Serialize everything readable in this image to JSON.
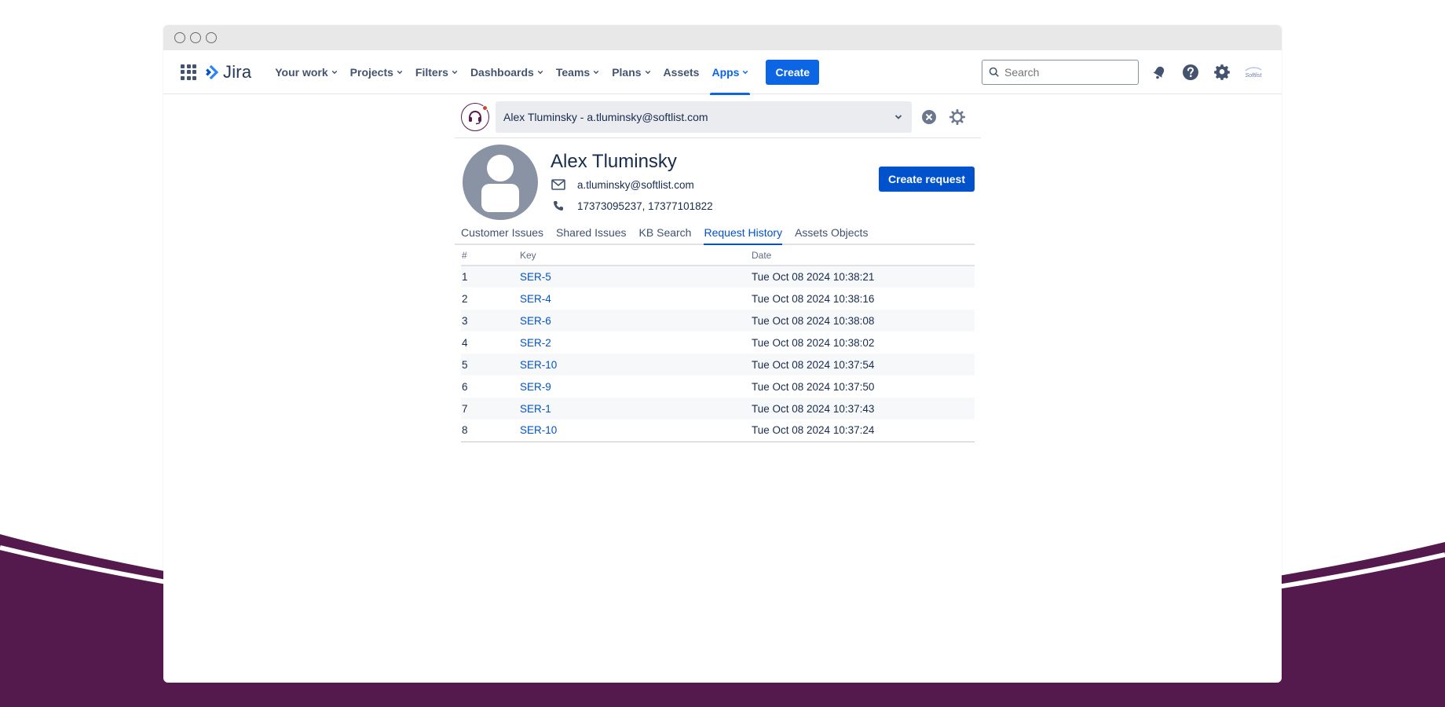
{
  "nav": {
    "logo": "Jira",
    "items": [
      {
        "label": "Your work",
        "dropdown": true
      },
      {
        "label": "Projects",
        "dropdown": true
      },
      {
        "label": "Filters",
        "dropdown": true
      },
      {
        "label": "Dashboards",
        "dropdown": true
      },
      {
        "label": "Teams",
        "dropdown": true
      },
      {
        "label": "Plans",
        "dropdown": true
      },
      {
        "label": "Assets",
        "dropdown": false
      },
      {
        "label": "Apps",
        "dropdown": true,
        "active": true
      }
    ],
    "create_label": "Create",
    "search_placeholder": "Search",
    "profile_logo_text": "Softlist"
  },
  "customer_picker": {
    "selected": "Alex Tluminsky - a.tluminsky@softlist.com"
  },
  "profile": {
    "name": "Alex Tluminsky",
    "email": "a.tluminsky@softlist.com",
    "phone": "17373095237, 17377101822",
    "create_request_label": "Create request"
  },
  "tabs": [
    {
      "label": "Customer Issues"
    },
    {
      "label": "Shared Issues"
    },
    {
      "label": "KB Search"
    },
    {
      "label": "Request History",
      "active": true
    },
    {
      "label": "Assets Objects"
    }
  ],
  "table": {
    "columns": [
      "#",
      "Key",
      "Date"
    ],
    "rows": [
      {
        "num": "1",
        "key": "SER-5",
        "date": "Tue Oct 08 2024 10:38:21"
      },
      {
        "num": "2",
        "key": "SER-4",
        "date": "Tue Oct 08 2024 10:38:16"
      },
      {
        "num": "3",
        "key": "SER-6",
        "date": "Tue Oct 08 2024 10:38:08"
      },
      {
        "num": "4",
        "key": "SER-2",
        "date": "Tue Oct 08 2024 10:38:02"
      },
      {
        "num": "5",
        "key": "SER-10",
        "date": "Tue Oct 08 2024 10:37:54"
      },
      {
        "num": "6",
        "key": "SER-9",
        "date": "Tue Oct 08 2024 10:37:50"
      },
      {
        "num": "7",
        "key": "SER-1",
        "date": "Tue Oct 08 2024 10:37:43"
      },
      {
        "num": "8",
        "key": "SER-10",
        "date": "Tue Oct 08 2024 10:37:24"
      }
    ]
  },
  "colors": {
    "accent": "#0c66e4",
    "button": "#0052cc",
    "background_wave": "#54194d",
    "avatar": "#8993a4"
  }
}
